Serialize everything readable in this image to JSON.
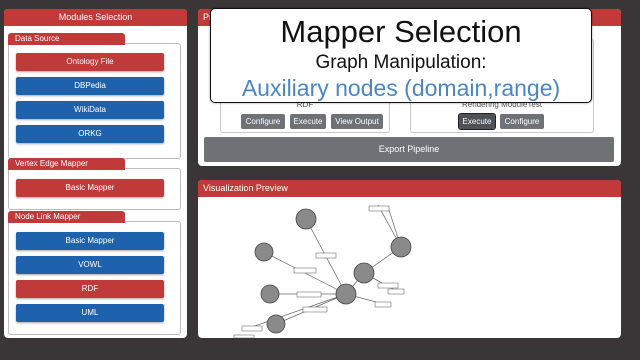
{
  "modules_panel": {
    "title": "Modules Selection",
    "data_source": {
      "title": "Data Source",
      "items": [
        "Ontology File",
        "DBPedia",
        "WikiData",
        "ORKG"
      ]
    },
    "vertex_edge_mapper": {
      "title": "Vertex Edge Mapper",
      "items": [
        "Basic Mapper"
      ]
    },
    "node_link_mapper": {
      "title": "Node Link Mapper",
      "items": [
        "Basic Mapper",
        "VOWL",
        "RDF",
        "UML"
      ]
    }
  },
  "pipeline_panel": {
    "title": "Pi",
    "stage_left": {
      "label": "RDF",
      "buttons": [
        "Configure",
        "Execute",
        "View Output"
      ]
    },
    "stage_right": {
      "label": "Rendering ModuleTest",
      "buttons": [
        "Execute",
        "Configure"
      ]
    },
    "export": "Export Pipeline"
  },
  "viz_panel": {
    "title": "Visualization Preview"
  },
  "overlay": {
    "title": "Mapper Selection",
    "subtitle": "Graph Manipulation:",
    "highlight": "Auxiliary nodes (domain,range)"
  },
  "colors": {
    "accent_red": "#c03a3a",
    "accent_blue": "#1e62ad",
    "button_gray": "#6e7276",
    "highlight_text": "#4b86c4"
  }
}
